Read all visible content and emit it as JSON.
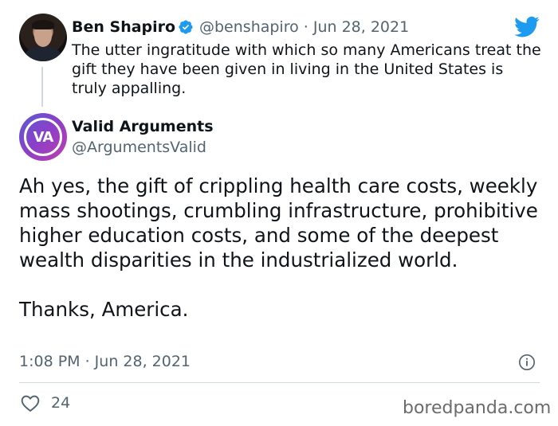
{
  "quoted_tweet": {
    "name": "Ben Shapiro",
    "handle_date": "@benshapiro · Jun 28, 2021",
    "text": "The utter ingratitude with which so many Americans treat the gift they have been given in living in the United States is truly appalling.",
    "verified": true
  },
  "main_tweet": {
    "name": "Valid Arguments",
    "handle": "@ArgumentsValid",
    "avatar_initials": "VA",
    "paragraph_1": "Ah yes, the gift of crippling health care costs, weekly mass shootings, crumbling infrastructure, prohibitive higher education costs, and some of the deepest wealth disparities in the industrialized world.",
    "paragraph_2": "Thanks, America.",
    "timestamp": "1:08 PM · Jun 28, 2021",
    "likes": "24"
  },
  "watermark": "boredpanda.com",
  "colors": {
    "twitter_blue": "#1d9bf0",
    "secondary_text": "#536471",
    "divider": "#cfd9de"
  }
}
